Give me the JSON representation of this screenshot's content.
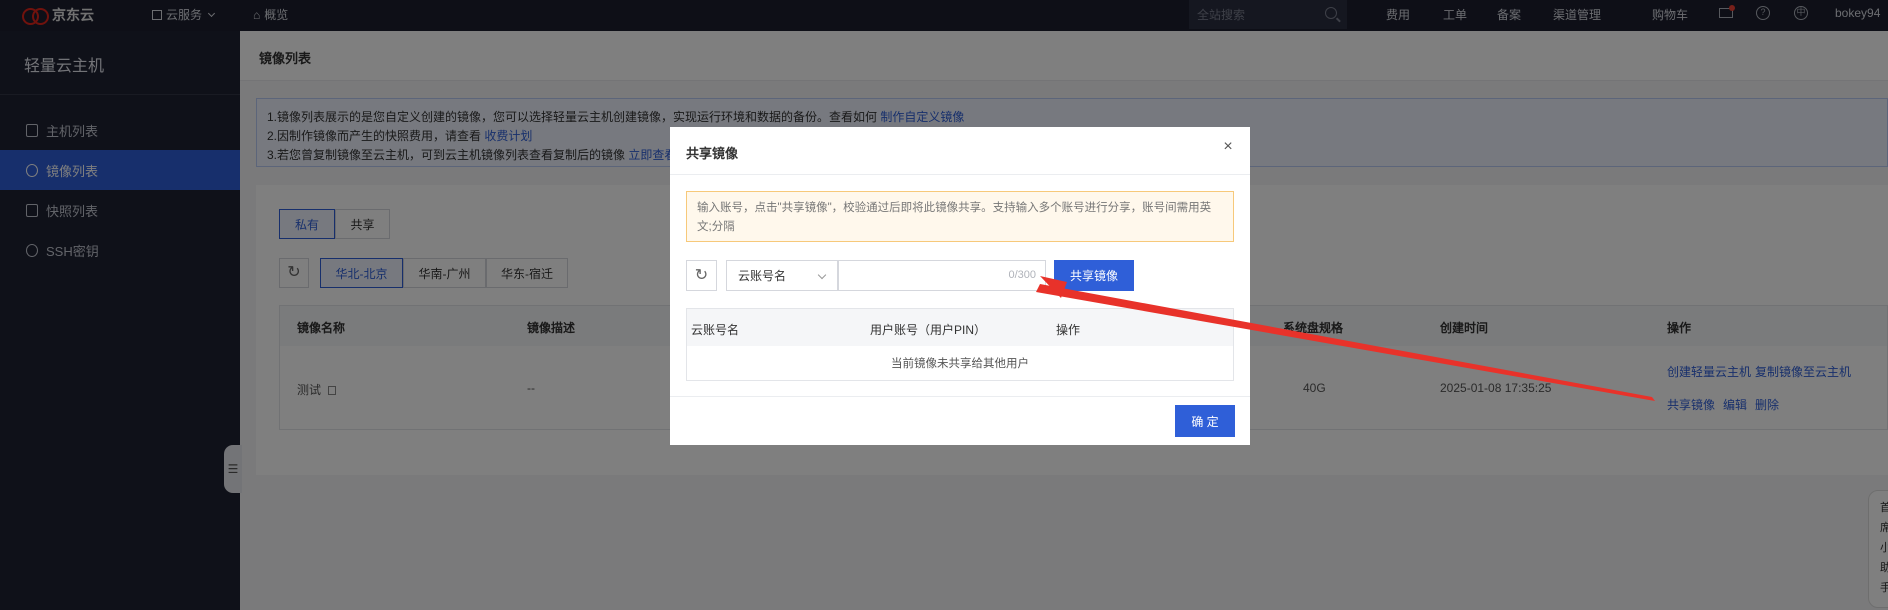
{
  "brand": {
    "logo_text": "京东云"
  },
  "topnav": {
    "cloud_services": "云服务",
    "overview": "概览",
    "search_placeholder": "全站搜索",
    "links": [
      "费用",
      "工单",
      "备案",
      "渠道管理",
      "购物车"
    ],
    "help_icon_glyph": "?",
    "lang_icon_glyph": "中",
    "user": "bokey94"
  },
  "sidebar": {
    "title": "轻量云主机",
    "items": [
      {
        "label": "主机列表",
        "icon": "host-list-icon"
      },
      {
        "label": "镜像列表",
        "icon": "image-icon"
      },
      {
        "label": "快照列表",
        "icon": "snapshot-icon"
      },
      {
        "label": "SSH密钥",
        "icon": "key-icon"
      }
    ]
  },
  "main": {
    "title": "镜像列表",
    "info": {
      "line1": "1.镜像列表展示的是您自定义创建的镜像，您可以选择轻量云主机创建镜像，实现运行环境和数据的备份。查看如何",
      "line1_link": "制作自定义镜像",
      "line2": "2.因制作镜像而产生的快照费用，请查看",
      "line2_link": "收费计划",
      "line3": "3.若您曾复制镜像至云主机，可到云主机镜像列表查看复制后的镜像",
      "line3_link": "立即查看"
    },
    "tabs": [
      "私有",
      "共享"
    ],
    "regions": [
      "华北-北京",
      "华南-广州",
      "华东-宿迁"
    ],
    "table": {
      "headers": [
        "镜像名称",
        "镜像描述",
        "系统盘规格",
        "创建时间",
        "操作"
      ],
      "rows": [
        {
          "name": "测试",
          "description": "--",
          "disk": "40G",
          "created": "2025-01-08 17:35:25",
          "actions_row1": [
            "创建轻量云主机",
            "复制镜像至云主机"
          ],
          "actions_row2": [
            "共享镜像",
            "编辑",
            "删除"
          ]
        }
      ]
    },
    "collapse_glyph": "☰",
    "right_float_text": [
      "首",
      "席",
      "小",
      "助",
      "手"
    ]
  },
  "modal": {
    "title": "共享镜像",
    "close_glyph": "×",
    "notice": "输入账号，点击\"共享镜像\"，校验通过后即将此镜像共享。支持输入多个账号进行分享，账号间需用英文;分隔",
    "refresh_glyph": "↻",
    "select_value": "云账号名",
    "input_value": "",
    "counter": "0/300",
    "share_button": "共享镜像",
    "table_headers": [
      "云账号名",
      "用户账号（用户PIN）",
      "操作"
    ],
    "empty_text": "当前镜像未共享给其他用户",
    "ok_button": "确 定"
  },
  "colors": {
    "accent": "#2f5fd8",
    "topbar": "#1c1f2e",
    "sidebar": "#1f2233",
    "annotation_arrow": "#e8322a"
  }
}
